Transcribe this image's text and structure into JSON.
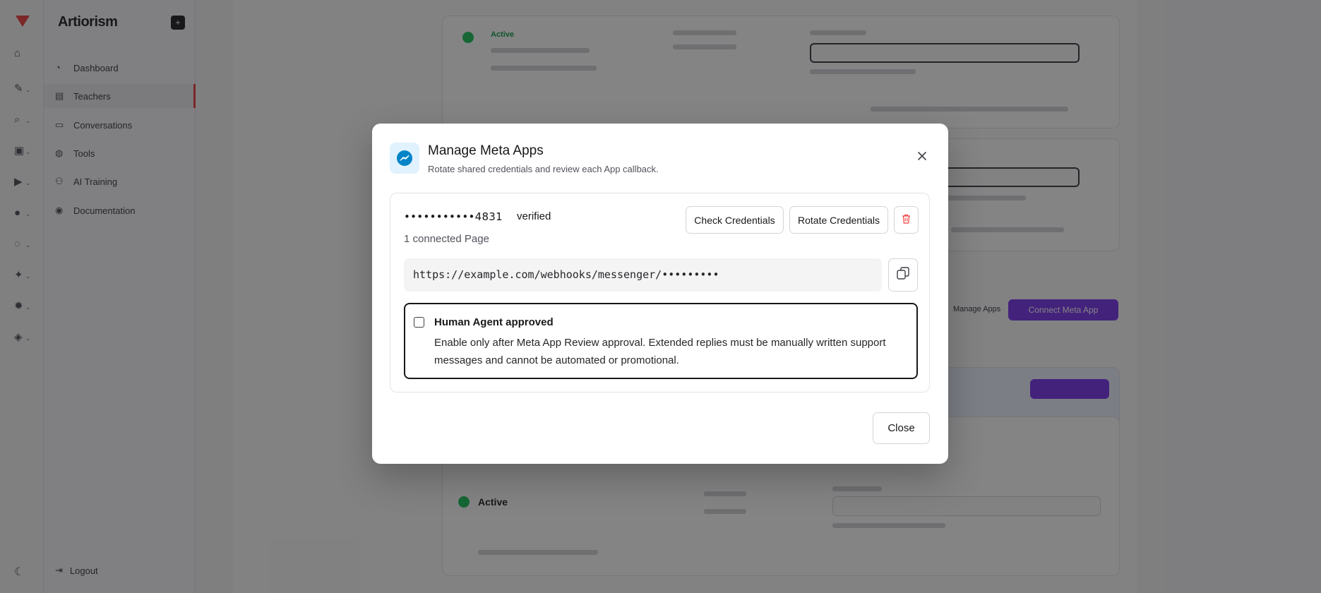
{
  "background": {
    "brand": "Artiorism",
    "nav": [
      {
        "label": "Dashboard",
        "icon": "dashboard-icon"
      },
      {
        "label": "Teachers",
        "icon": "teachers-icon",
        "active": true
      },
      {
        "label": "Conversations",
        "icon": "conversations-icon"
      },
      {
        "label": "Tools",
        "icon": "tools-icon"
      },
      {
        "label": "AI Training",
        "icon": "ai-training-icon"
      },
      {
        "label": "Documentation",
        "icon": "documentation-icon"
      }
    ],
    "logout": "Logout",
    "status_active": "Active",
    "manage_apps": "Manage Apps",
    "connect_meta_app": "Connect Meta App"
  },
  "modal": {
    "title": "Manage Meta Apps",
    "subtitle": "Rotate shared credentials and review each App callback.",
    "app": {
      "masked_key": "•••••••••••4831",
      "status": "verified",
      "pages": "1 connected Page",
      "check_label": "Check Credentials",
      "rotate_label": "Rotate Credentials",
      "webhook_url": "https://example.com/webhooks/messenger/•••••••••",
      "human_agent": {
        "title": "Human Agent approved",
        "description": "Enable only after Meta App Review approval. Extended replies must be manually written support messages and cannot be automated or promotional.",
        "checked": false
      }
    },
    "close_label": "Close"
  },
  "colors": {
    "accent": "#7c3aed",
    "messenger": "#0284c7",
    "danger": "#ef4444",
    "success": "#22c55e"
  }
}
